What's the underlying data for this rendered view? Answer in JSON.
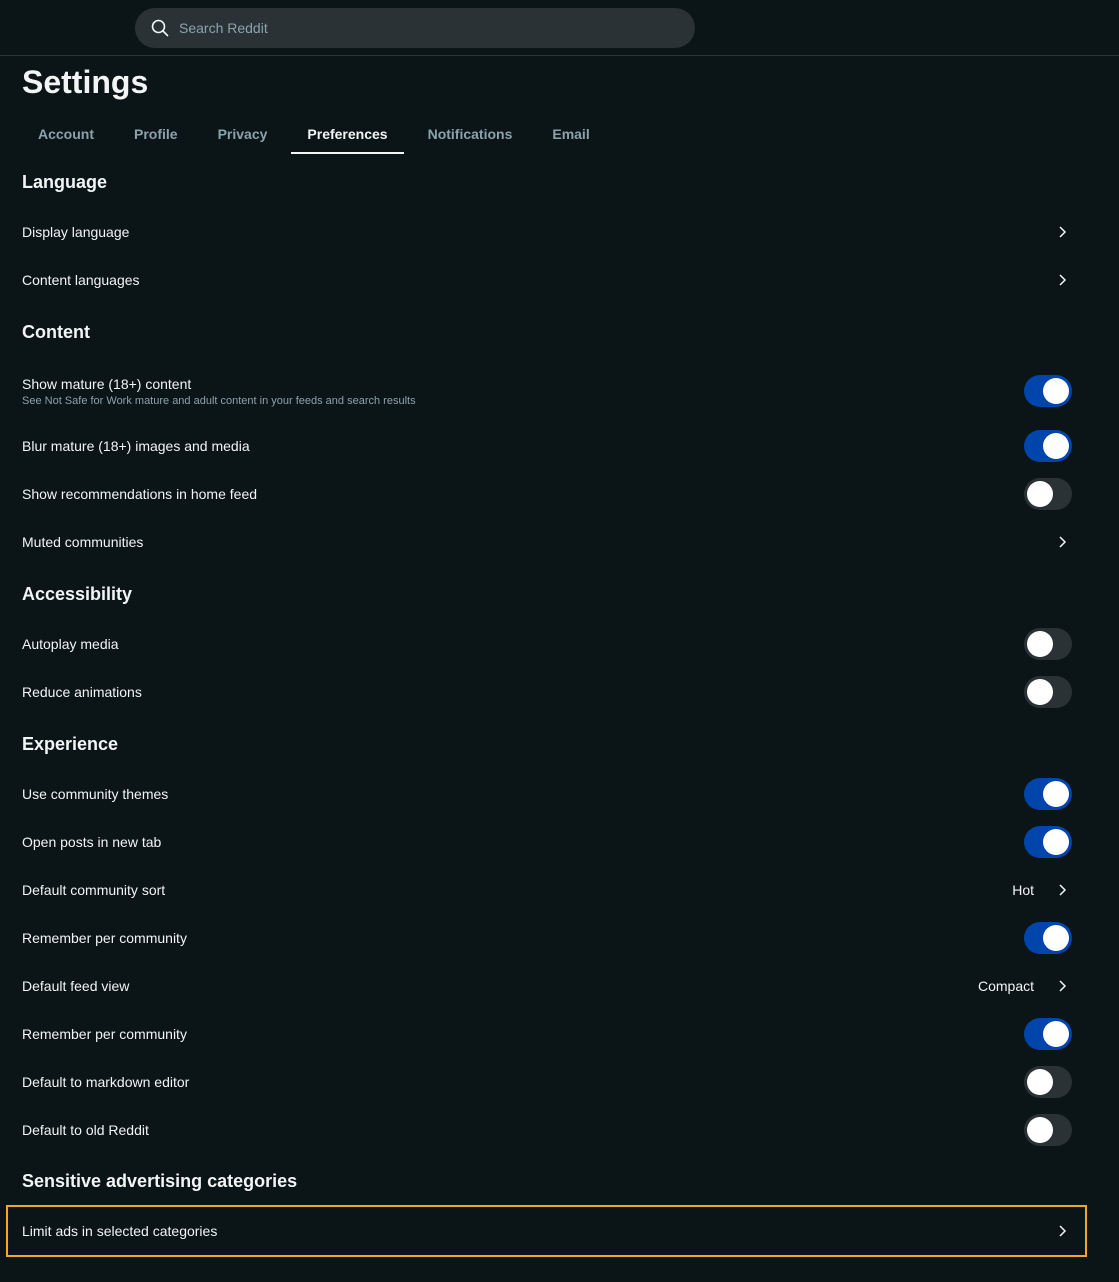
{
  "search": {
    "placeholder": "Search Reddit"
  },
  "page": {
    "title": "Settings"
  },
  "tabs": [
    {
      "label": "Account"
    },
    {
      "label": "Profile"
    },
    {
      "label": "Privacy"
    },
    {
      "label": "Preferences",
      "active": true
    },
    {
      "label": "Notifications"
    },
    {
      "label": "Email"
    }
  ],
  "sections": {
    "language": {
      "heading": "Language",
      "display_language": "Display language",
      "content_languages": "Content languages"
    },
    "content": {
      "heading": "Content",
      "show_mature": {
        "label": "Show mature (18+) content",
        "description": "See Not Safe for Work mature and adult content in your feeds and search results",
        "on": true
      },
      "blur_mature": {
        "label": "Blur mature (18+) images and media",
        "on": true
      },
      "recommendations": {
        "label": "Show recommendations in home feed",
        "on": false
      },
      "muted_communities": "Muted communities"
    },
    "accessibility": {
      "heading": "Accessibility",
      "autoplay": {
        "label": "Autoplay media",
        "on": false
      },
      "reduce_animations": {
        "label": "Reduce animations",
        "on": false
      }
    },
    "experience": {
      "heading": "Experience",
      "community_themes": {
        "label": "Use community themes",
        "on": true
      },
      "open_new_tab": {
        "label": "Open posts in new tab",
        "on": true
      },
      "default_sort": {
        "label": "Default community sort",
        "value": "Hot"
      },
      "remember_sort": {
        "label": "Remember per community",
        "on": true
      },
      "default_feed_view": {
        "label": "Default feed view",
        "value": "Compact"
      },
      "remember_view": {
        "label": "Remember per community",
        "on": true
      },
      "markdown_editor": {
        "label": "Default to markdown editor",
        "on": false
      },
      "old_reddit": {
        "label": "Default to old Reddit",
        "on": false
      }
    },
    "ads": {
      "heading": "Sensitive advertising categories",
      "limit_ads": "Limit ads in selected categories"
    }
  },
  "colors": {
    "background": "#0b1416",
    "toggle_on": "#0045ac",
    "toggle_off": "#2a3236",
    "highlight": "#f5a623"
  },
  "icons": {
    "search": "search-icon",
    "chevron": "chevron-right-icon"
  }
}
